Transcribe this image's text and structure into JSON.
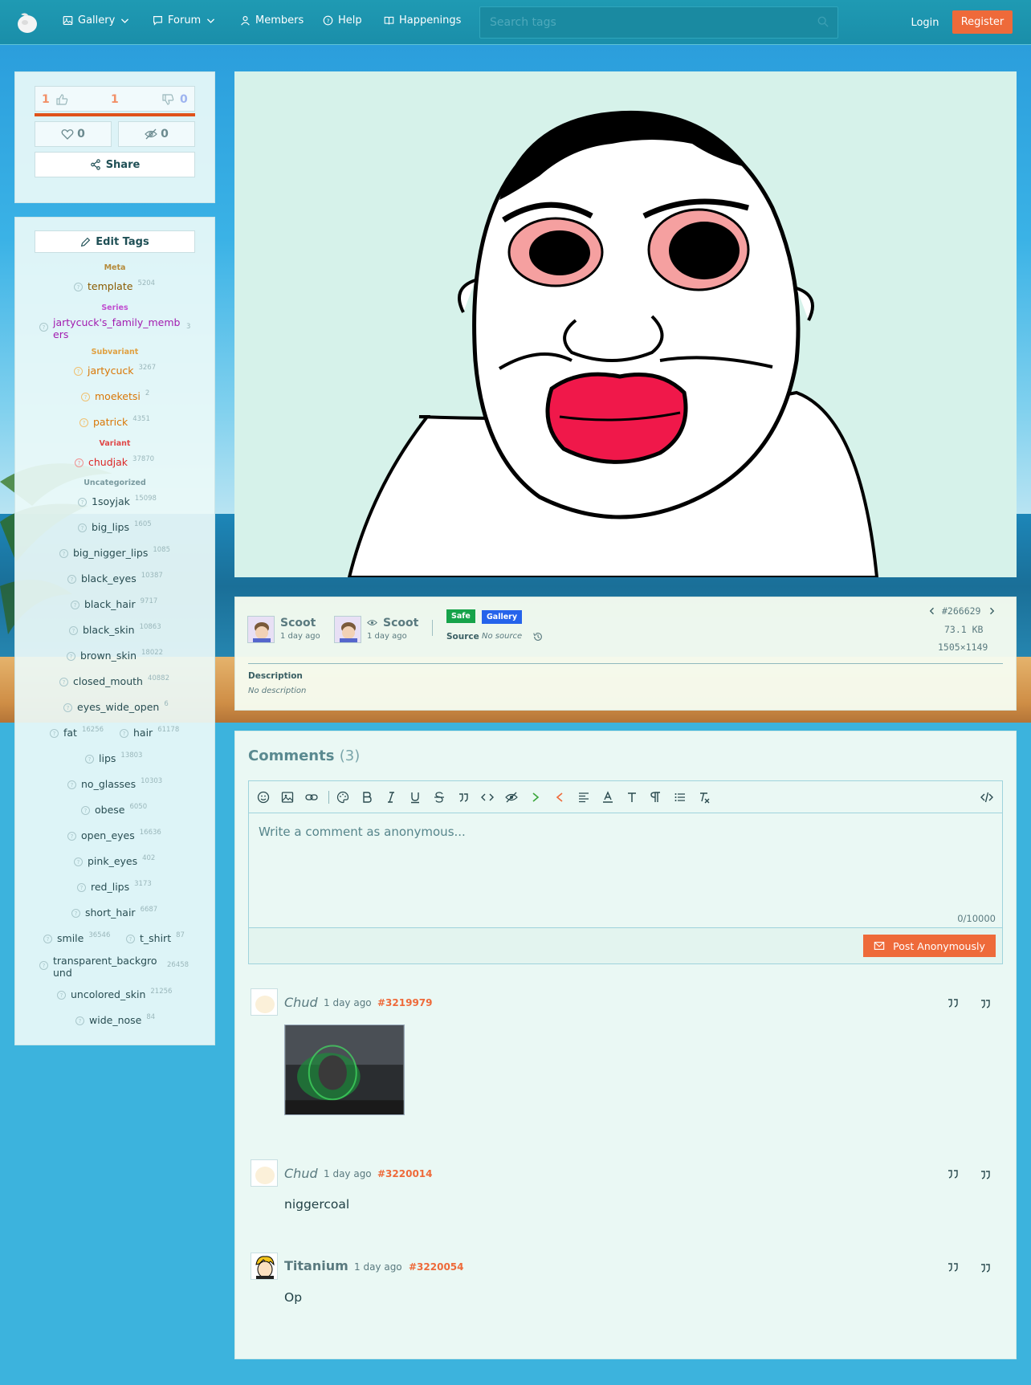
{
  "nav": {
    "items": [
      {
        "label": "Gallery",
        "icon": "image-icon",
        "dropdown": true
      },
      {
        "label": "Forum",
        "icon": "chat-icon",
        "dropdown": true
      },
      {
        "label": "Members",
        "icon": "user-icon",
        "dropdown": false
      },
      {
        "label": "Help",
        "icon": "help-circle-icon",
        "dropdown": false
      },
      {
        "label": "Happenings",
        "icon": "book-icon",
        "dropdown": false
      }
    ],
    "search_placeholder": "Search tags",
    "login": "Login",
    "register": "Register"
  },
  "votes": {
    "up": "1",
    "score": "1",
    "down": "0",
    "favorites": "0",
    "hides": "0",
    "share": "Share"
  },
  "tags": {
    "edit_label": "Edit Tags",
    "categories": {
      "meta": "Meta",
      "series": "Series",
      "subvariant": "Subvariant",
      "variant": "Variant",
      "uncategorized": "Uncategorized"
    },
    "items": [
      {
        "name": "template",
        "count": "5204"
      },
      {
        "name": "jartycuck's_family_members",
        "count": "3"
      },
      {
        "name": "jartycuck",
        "count": "3267"
      },
      {
        "name": "moeketsi",
        "count": "2"
      },
      {
        "name": "patrick",
        "count": "4351"
      },
      {
        "name": "chudjak",
        "count": "37870"
      },
      {
        "name": "1soyjak",
        "count": "15098"
      },
      {
        "name": "big_lips",
        "count": "1605"
      },
      {
        "name": "big_nigger_lips",
        "count": "1085"
      },
      {
        "name": "black_eyes",
        "count": "10387"
      },
      {
        "name": "black_hair",
        "count": "9717"
      },
      {
        "name": "black_skin",
        "count": "10863"
      },
      {
        "name": "brown_skin",
        "count": "18022"
      },
      {
        "name": "closed_mouth",
        "count": "40882"
      },
      {
        "name": "eyes_wide_open",
        "count": "6"
      },
      {
        "name": "fat",
        "count": "16256"
      },
      {
        "name": "hair",
        "count": "61178"
      },
      {
        "name": "lips",
        "count": "13803"
      },
      {
        "name": "no_glasses",
        "count": "10303"
      },
      {
        "name": "obese",
        "count": "6050"
      },
      {
        "name": "open_eyes",
        "count": "16636"
      },
      {
        "name": "pink_eyes",
        "count": "402"
      },
      {
        "name": "red_lips",
        "count": "3173"
      },
      {
        "name": "short_hair",
        "count": "6687"
      },
      {
        "name": "smile",
        "count": "36546"
      },
      {
        "name": "t_shirt",
        "count": "87"
      },
      {
        "name": "transparent_background",
        "count": "26458"
      },
      {
        "name": "uncolored_skin",
        "count": "21256"
      },
      {
        "name": "wide_nose",
        "count": "84"
      }
    ]
  },
  "post": {
    "uploader": "Scoot",
    "uploader_time": "1 day ago",
    "approver": "Scoot",
    "approver_time": "1 day ago",
    "rating": "Safe",
    "board": "Gallery",
    "source_label": "Source",
    "source_value": "No source",
    "id": "#266629",
    "size": "73.1 KB",
    "dimensions": "1505×1149",
    "description_label": "Description",
    "description_value": "No description"
  },
  "comments": {
    "title": "Comments",
    "count": "(3)",
    "placeholder": "Write a comment as anonymous...",
    "char_count": "0/10000",
    "post_button": "Post Anonymously",
    "list": [
      {
        "author": "Chud",
        "time": "1 day ago",
        "id": "#3219979",
        "body": ""
      },
      {
        "author": "Chud",
        "time": "1 day ago",
        "id": "#3220014",
        "body": "niggercoal"
      },
      {
        "author": "Titanium",
        "time": "1 day ago",
        "id": "#3220054",
        "body": "Op"
      }
    ]
  },
  "colors": {
    "accent": "#ee6a3a",
    "nav": "#1a8ea9",
    "safe": "#16a34a",
    "gallery": "#2563eb",
    "meta_tag": "#8a5a00",
    "series_tag": "#a21caf",
    "subvariant_tag": "#d97706",
    "variant_tag": "#dc2626"
  }
}
